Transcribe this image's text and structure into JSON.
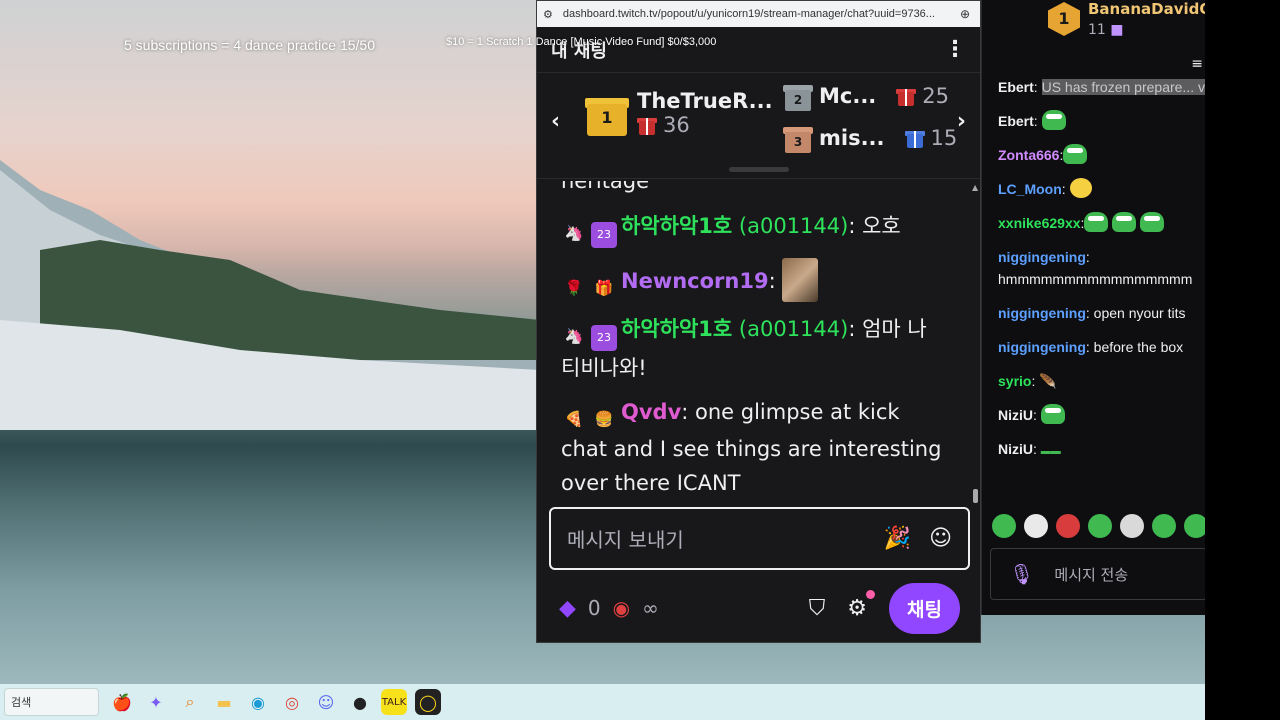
{
  "overlay": {
    "subs_text": "5 subscriptions = 4 dance practice 15/50",
    "fund_text": "$10 = 1 Scratch 1 Dance [Music Video Fund] $0/$3,000"
  },
  "taskbar": {
    "search_label": "검색"
  },
  "popout": {
    "url": "dashboard.twitch.tv/popout/u/yunicorn19/stream-manager/chat?uuid=9736...",
    "title": "내 채팅",
    "leaderboard": {
      "first_name": "TheTrueR...",
      "first_count": "36",
      "second_name": "Mc...",
      "second_count": "25",
      "third_name": "mis...",
      "third_count": "15",
      "rank1": "1",
      "rank2": "2",
      "rank3": "3"
    },
    "truncated_text": "heritage",
    "messages": [
      {
        "user": "하악하악1호",
        "login": "(a001144)",
        "text": ": 오호",
        "badge1": "🦄",
        "badge2": "23",
        "color": "#2ee35b"
      },
      {
        "user": "Newncorn19",
        "login": "",
        "text": ":",
        "badge1": "🌹",
        "badge2": "🎁",
        "color": "#b26cf2"
      },
      {
        "user": "하악하악1호",
        "login": "(a001144)",
        "text": ": 엄마 나 티비나와!",
        "badge1": "🦄",
        "badge2": "23",
        "color": "#2ee35b"
      },
      {
        "user": "Qvdv",
        "login": "",
        "text": ": one glimpse at kick chat and I see things are interesting over there ICANT",
        "badge1": "🍕",
        "badge2": "🍔",
        "color": "#e05bd0"
      }
    ],
    "input_placeholder": "메시지 보내기",
    "bits_count": "0",
    "channel_points": "∞",
    "chat_button": "채팅"
  },
  "right_panel": {
    "top_user": "BananaDavidO...",
    "top_count": "11",
    "top_rank": "1",
    "messages": [
      {
        "user": "Ebert",
        "text": "US has frozen prepare... very good.",
        "color": "#ffffff"
      },
      {
        "user": "Ebert",
        "text": "",
        "color": "#ffffff"
      },
      {
        "user": "Zonta666",
        "text": "",
        "color": "#d18cff"
      },
      {
        "user": "LC_Moon",
        "text": "",
        "color": "#5ea0ff"
      },
      {
        "user": "xxnike629xx",
        "text": "",
        "color": "#2ee35b"
      },
      {
        "user": "niggingening",
        "text": "hmmmmmmmmmmmmmmmm",
        "color": "#5ea0ff"
      },
      {
        "user": "niggingening",
        "text": "open nyour tits",
        "color": "#5ea0ff"
      },
      {
        "user": "niggingening",
        "text": "before the box",
        "color": "#5ea0ff"
      },
      {
        "user": "syrio",
        "text": "",
        "color": "#2ee35b"
      },
      {
        "user": "NiziU",
        "text": "",
        "color": "#ffffff"
      },
      {
        "user": "NiziU",
        "text": "",
        "color": "#ffffff"
      }
    ],
    "input_placeholder": "메시지 전송"
  }
}
